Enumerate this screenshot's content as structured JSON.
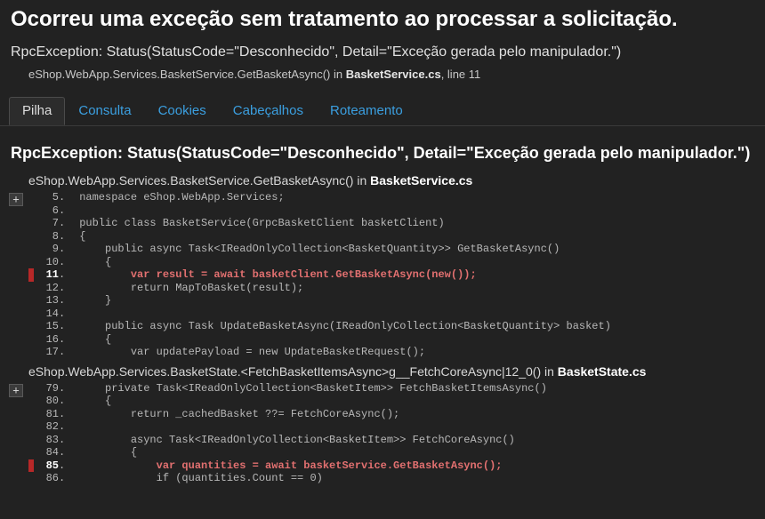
{
  "title": "Ocorreu uma exceção sem tratamento ao processar a solicitação.",
  "subheading": "RpcException: Status(StatusCode=\"Desconhecido\", Detail=\"Exceção gerada pelo manipulador.\")",
  "location": {
    "prefix": "eShop.WebApp.Services.BasketService.GetBasketAsync() in ",
    "file": "BasketService.cs",
    "suffix": ", line 11"
  },
  "tabs": {
    "stack": "Pilha",
    "query": "Consulta",
    "cookies": "Cookies",
    "headers": "Cabeçalhos",
    "routing": "Roteamento"
  },
  "section_heading": "RpcException: Status(StatusCode=\"Desconhecido\", Detail=\"Exceção gerada pelo manipulador.\")",
  "frames": [
    {
      "header_prefix": "eShop.WebApp.Services.BasketService.GetBasketAsync() in ",
      "header_file": "BasketService.cs",
      "expand_label": "+",
      "lines": [
        {
          "n": "5",
          "hl": false,
          "code": "namespace eShop.WebApp.Services;"
        },
        {
          "n": "6",
          "hl": false,
          "code": ""
        },
        {
          "n": "7",
          "hl": false,
          "code": "public class BasketService(GrpcBasketClient basketClient)"
        },
        {
          "n": "8",
          "hl": false,
          "code": "{"
        },
        {
          "n": "9",
          "hl": false,
          "code": "    public async Task<IReadOnlyCollection<BasketQuantity>> GetBasketAsync()"
        },
        {
          "n": "10",
          "hl": false,
          "code": "    {"
        },
        {
          "n": "11",
          "hl": true,
          "code": "        var result = await basketClient.GetBasketAsync(new());"
        },
        {
          "n": "12",
          "hl": false,
          "code": "        return MapToBasket(result);"
        },
        {
          "n": "13",
          "hl": false,
          "code": "    }"
        },
        {
          "n": "14",
          "hl": false,
          "code": ""
        },
        {
          "n": "15",
          "hl": false,
          "code": "    public async Task UpdateBasketAsync(IReadOnlyCollection<BasketQuantity> basket)"
        },
        {
          "n": "16",
          "hl": false,
          "code": "    {"
        },
        {
          "n": "17",
          "hl": false,
          "code": "        var updatePayload = new UpdateBasketRequest();"
        }
      ]
    },
    {
      "header_prefix": "eShop.WebApp.Services.BasketState.<FetchBasketItemsAsync>g__FetchCoreAsync|12_0() in ",
      "header_file": "BasketState.cs",
      "expand_label": "+",
      "lines": [
        {
          "n": "79",
          "hl": false,
          "code": "    private Task<IReadOnlyCollection<BasketItem>> FetchBasketItemsAsync()"
        },
        {
          "n": "80",
          "hl": false,
          "code": "    {"
        },
        {
          "n": "81",
          "hl": false,
          "code": "        return _cachedBasket ??= FetchCoreAsync();"
        },
        {
          "n": "82",
          "hl": false,
          "code": ""
        },
        {
          "n": "83",
          "hl": false,
          "code": "        async Task<IReadOnlyCollection<BasketItem>> FetchCoreAsync()"
        },
        {
          "n": "84",
          "hl": false,
          "code": "        {"
        },
        {
          "n": "85",
          "hl": true,
          "code": "            var quantities = await basketService.GetBasketAsync();"
        },
        {
          "n": "86",
          "hl": false,
          "code": "            if (quantities.Count == 0)"
        }
      ]
    }
  ]
}
